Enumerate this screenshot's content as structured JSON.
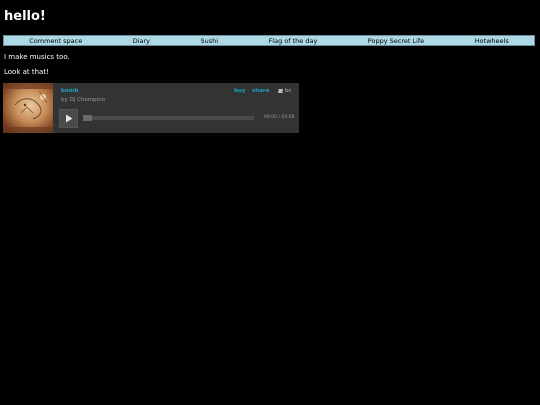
{
  "page": {
    "title": "hello!"
  },
  "nav": {
    "items": [
      {
        "label": "Comment space"
      },
      {
        "label": "Diary"
      },
      {
        "label": "Sushi"
      },
      {
        "label": "Flag of the day"
      },
      {
        "label": "Poppy Secret Life"
      },
      {
        "label": "Hotwheels"
      }
    ],
    "background": "#add8e6"
  },
  "content": {
    "paragraph1": "I make musics too.",
    "paragraph2": "Look at that!"
  },
  "player": {
    "track_title": "bomb",
    "by_prefix": "by",
    "artist": "DJ Chompino",
    "buy_label": "buy",
    "share_label": "share",
    "logo_text": "bc",
    "logo_icon": "bandcamp-logo-icon",
    "play_icon": "play-icon",
    "elapsed": "00:00",
    "time_separator": "/",
    "duration": "04:08",
    "progress_fraction": 0,
    "accent_color": "#1da0c3",
    "background": "#333333"
  }
}
